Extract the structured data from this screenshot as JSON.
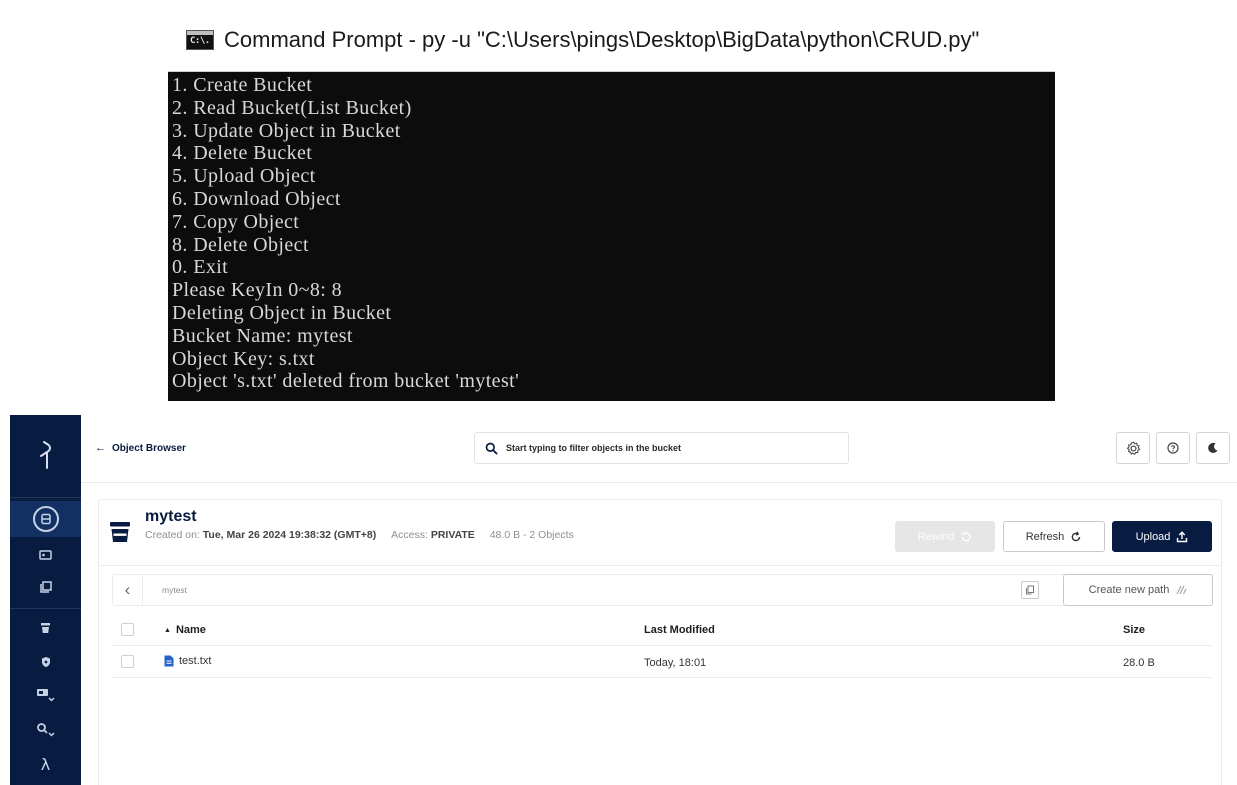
{
  "cmd": {
    "title": "Command Prompt - py  -u \"C:\\Users\\pings\\Desktop\\BigData\\python\\CRUD.py\"",
    "icon_label": "C:\\.",
    "lines": [
      "1. Create Bucket",
      "2. Read Bucket(List Bucket)",
      "3. Update Object in Bucket",
      "4. Delete Bucket",
      "5. Upload Object",
      "6. Download Object",
      "7. Copy Object",
      "8. Delete Object",
      "0. Exit",
      "Please KeyIn 0~8: 8",
      "Deleting Object in Bucket",
      "Bucket Name: mytest",
      "Object Key: s.txt",
      "Object 's.txt' deleted from bucket 'mytest'"
    ]
  },
  "topbar": {
    "back_label": "Object Browser",
    "search_placeholder": "Start typing to filter objects in the bucket"
  },
  "bucket": {
    "name": "mytest",
    "created_label": "Created on:",
    "created_value": "Tue, Mar 26 2024 19:38:32 (GMT+8)",
    "access_label": "Access:",
    "access_value": "PRIVATE",
    "summary": "48.0 B - 2 Objects"
  },
  "actions": {
    "rewind": "Rewind",
    "refresh": "Refresh",
    "upload": "Upload"
  },
  "path": {
    "current": "mytest",
    "new_path_label": "Create new path"
  },
  "table": {
    "headers": {
      "name": "Name",
      "modified": "Last Modified",
      "size": "Size"
    },
    "rows": [
      {
        "name": "test.txt",
        "modified": "Today, 18:01",
        "size": "28.0 B"
      }
    ]
  },
  "colors": {
    "sidebar": "#081c42",
    "primary": "#081c42",
    "file_icon": "#2563c9"
  }
}
